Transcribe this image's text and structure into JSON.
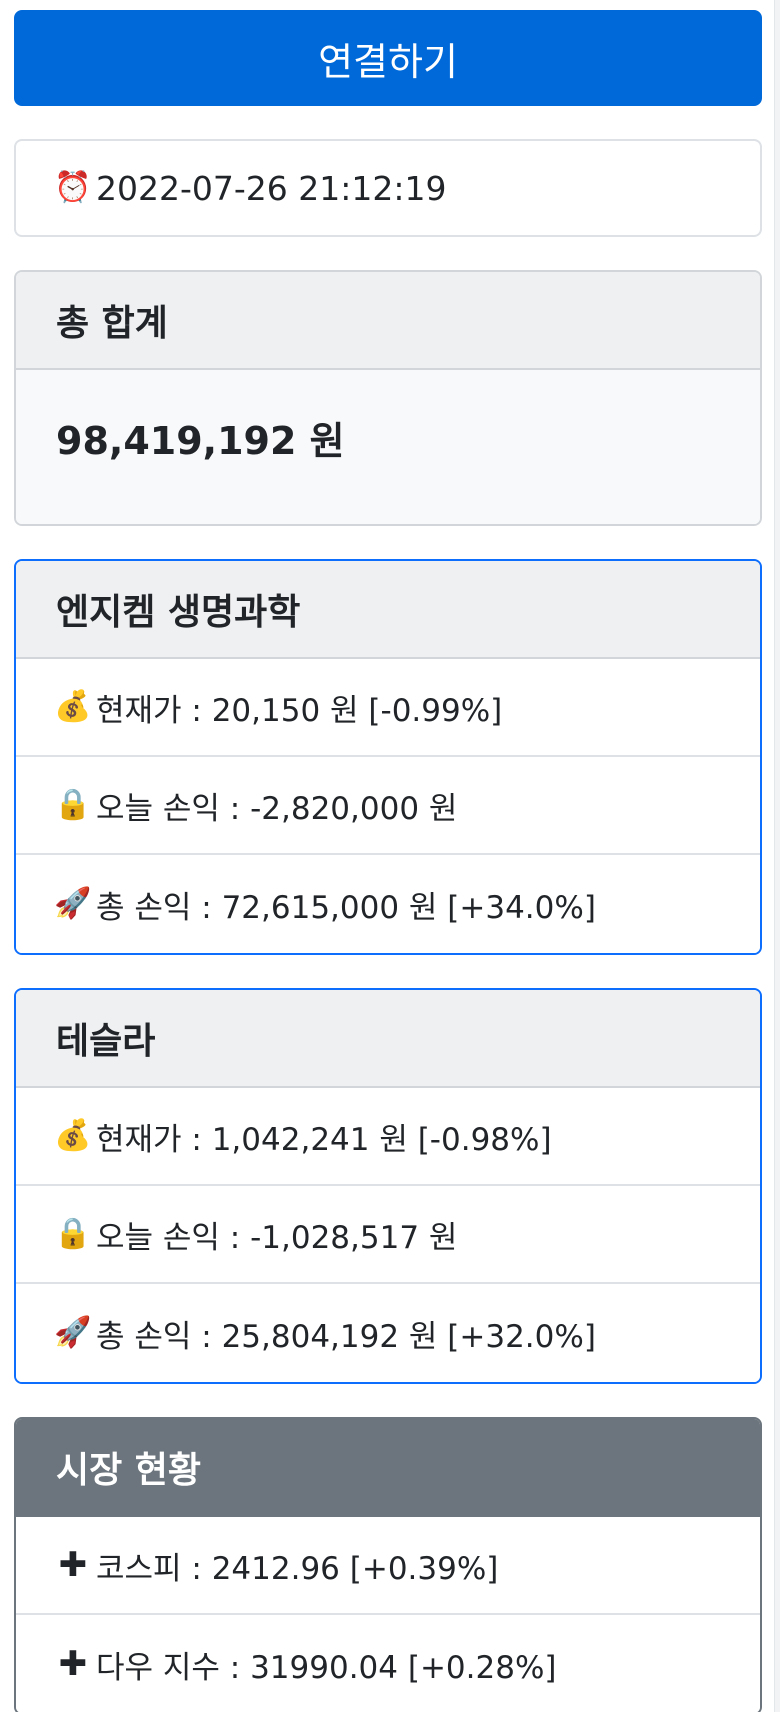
{
  "connect_button": {
    "label": "연결하기",
    "color": "#0069d9"
  },
  "timestamp": {
    "icon": "⏰",
    "icon_name": "alarm-clock-icon",
    "value": "2022-07-26 21:12:19"
  },
  "total": {
    "title": "총 합계",
    "value": "98,419,192 원"
  },
  "stocks": [
    {
      "name": "엔지켐 생명과학",
      "price": {
        "icon": "💰",
        "icon_name": "money-bag-icon",
        "text": "현재가 : 20,150 원 [-0.99%]"
      },
      "today": {
        "icon": "🔒",
        "icon_name": "lock-icon",
        "text": "오늘 손익 : -2,820,000 원"
      },
      "total": {
        "icon": "🚀",
        "icon_name": "rocket-icon",
        "text": "총 손익 : 72,615,000 원 [+34.0%]"
      }
    },
    {
      "name": "테슬라",
      "price": {
        "icon": "💰",
        "icon_name": "money-bag-icon",
        "text": "현재가 : 1,042,241 원 [-0.98%]"
      },
      "today": {
        "icon": "🔒",
        "icon_name": "lock-icon",
        "text": "오늘 손익 : -1,028,517 원"
      },
      "total": {
        "icon": "🚀",
        "icon_name": "rocket-icon",
        "text": "총 손익 : 25,804,192 원 [+32.0%]"
      }
    }
  ],
  "market": {
    "title": "시장 현황",
    "items": [
      {
        "icon": "✚",
        "icon_name": "plus-icon",
        "text": "코스피 : 2412.96 [+0.39%]"
      },
      {
        "icon": "✚",
        "icon_name": "plus-icon",
        "text": "다우 지수 : 31990.04 [+0.28%]"
      }
    ]
  }
}
